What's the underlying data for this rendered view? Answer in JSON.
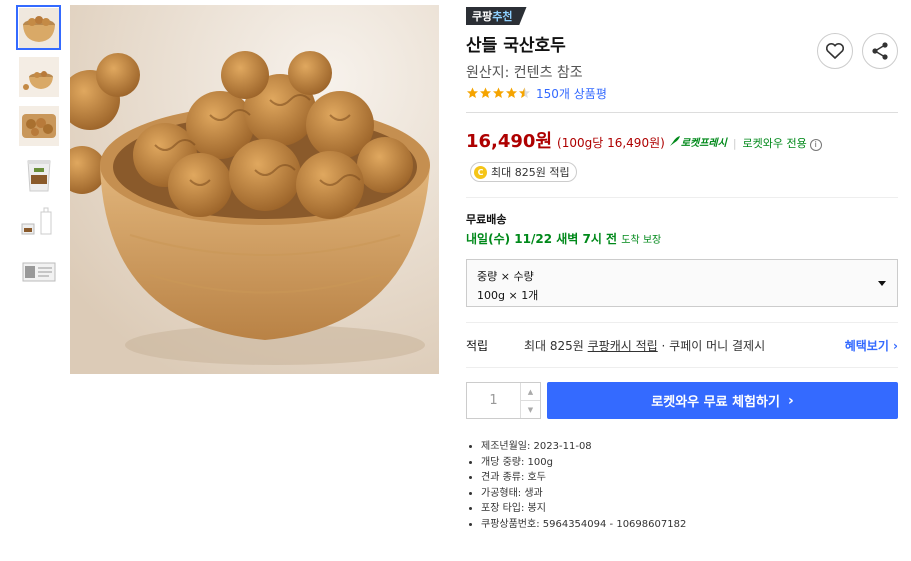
{
  "badge": {
    "prefix": "쿠팡",
    "accent": "추천"
  },
  "product": {
    "title": "산들 국산호두",
    "origin": "원산지: 컨텐츠 참조",
    "rating": 4.5,
    "reviews": "150개 상품평"
  },
  "price": {
    "value": "16,490원",
    "unit": "(100g당 16,490원)",
    "rocket_label": "로켓프레시",
    "wow_label": "로켓와우 전용",
    "cash_reward": "최대 825원 적립"
  },
  "shipping": {
    "label": "무료배송",
    "date": "내일(수) 11/22 새벽 7시 전",
    "guarantee": "도착 보장"
  },
  "option": {
    "header": "중량 × 수량",
    "value": "100g × 1개"
  },
  "earn": {
    "label": "적립",
    "prefix": "최대 825원 ",
    "link": "쿠팡캐시 적립",
    "suffix": " · 쿠페이 머니 결제시",
    "benefit": "혜택보기 ›"
  },
  "buy": {
    "quantity": "1",
    "button": "로켓와우 무료 체험하기",
    "button_chevron": "›"
  },
  "attributes": [
    "제조년월일: 2023-11-08",
    "개당 중량: 100g",
    "견과 종류: 호두",
    "가공형태: 생과",
    "포장 타입: 봉지",
    "쿠팡상품번호: 5964354094 - 10698607182"
  ],
  "colors": {
    "accent_blue": "#346aff",
    "price_red": "#ae0000",
    "rocket_green": "#00891a"
  },
  "icons": [
    "heart-icon",
    "share-icon",
    "star-icon",
    "rocket-icon",
    "info-icon",
    "coin-icon",
    "chevron-down-icon"
  ]
}
